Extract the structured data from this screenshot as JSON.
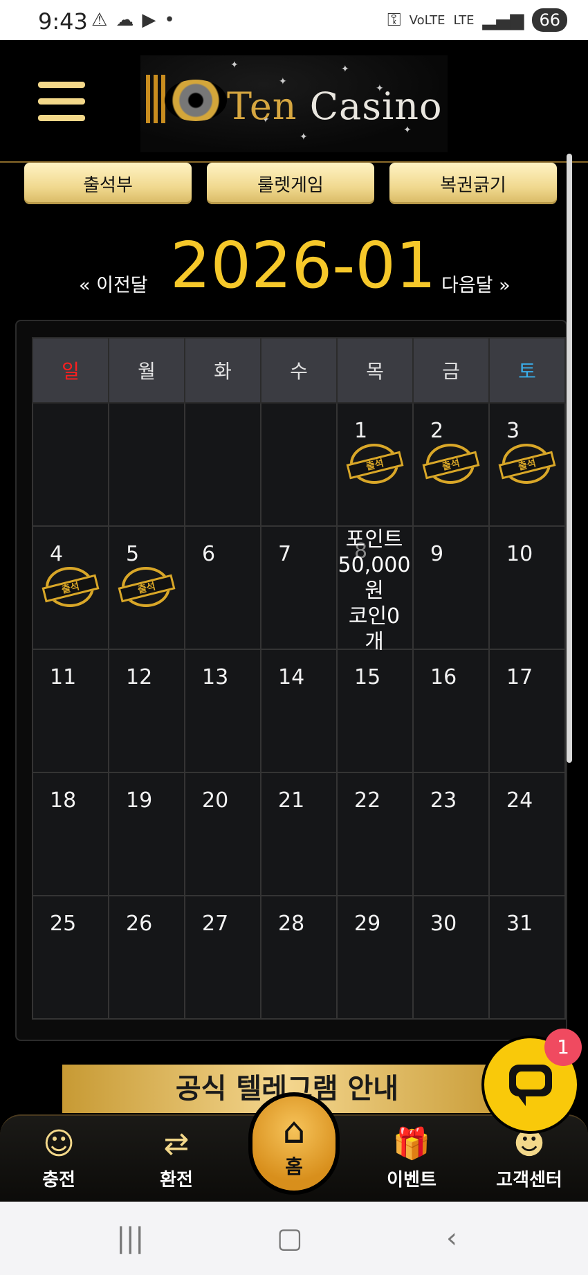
{
  "status_bar": {
    "time": "9:43",
    "icons_left": [
      "warning-icon",
      "cloud-icon",
      "youtube-icon",
      "dot-icon"
    ],
    "icons_right": [
      "key-icon",
      "volte-icon",
      "lte-icon",
      "signal-icon"
    ],
    "battery": "66"
  },
  "header": {
    "logo_text_ten": "Ten",
    "logo_text_casino": "Casino"
  },
  "top_buttons": [
    "출석부",
    "룰렛게임",
    "복권긁기"
  ],
  "month_nav": {
    "prev": "« 이전달",
    "current": "2026-01",
    "next": "다음달 »"
  },
  "calendar": {
    "weekdays": [
      "일",
      "월",
      "화",
      "수",
      "목",
      "금",
      "토"
    ],
    "weeks": [
      [
        "",
        "",
        "",
        "",
        "1",
        "2",
        "3"
      ],
      [
        "4",
        "5",
        "6",
        "7",
        "8",
        "9",
        "10"
      ],
      [
        "11",
        "12",
        "13",
        "14",
        "15",
        "16",
        "17"
      ],
      [
        "18",
        "19",
        "20",
        "21",
        "22",
        "23",
        "24"
      ],
      [
        "25",
        "26",
        "27",
        "28",
        "29",
        "30",
        "31"
      ]
    ],
    "stamp_label": "출석",
    "attended_days": [
      "1",
      "2",
      "3",
      "4",
      "5"
    ],
    "point_info": {
      "line1": "포인트",
      "line2": "50,000",
      "line3": "원",
      "line4": "코인0",
      "line5": "개"
    }
  },
  "banner": "공식 텔레그램 안내",
  "bottom_nav": {
    "charge": "충전",
    "exchange": "환전",
    "home": "홈",
    "event": "이벤트",
    "support": "고객센터"
  },
  "chat": {
    "badge": "1"
  },
  "colors": {
    "accent_gold": "#f6c82a",
    "sunday": "#ff1f1f",
    "saturday": "#3aaeea",
    "chat_yellow": "#f9c90a",
    "badge_red": "#f04a60"
  }
}
